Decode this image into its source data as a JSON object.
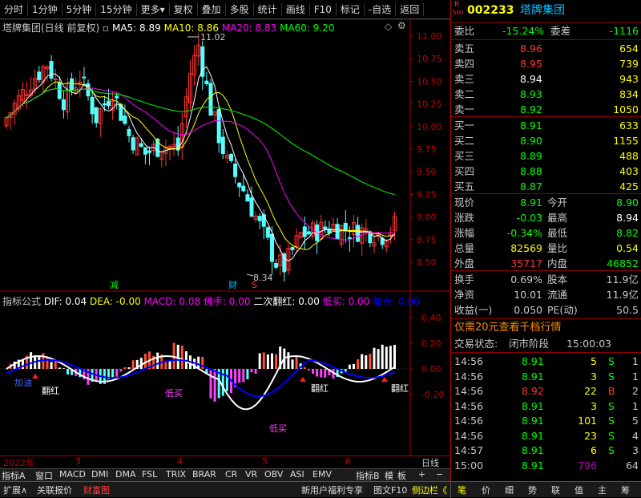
{
  "toolbar": {
    "items": [
      "分时",
      "1分钟",
      "5分钟",
      "15分钟",
      "更多",
      "复权",
      "叠加",
      "多股",
      "统计",
      "画线",
      "F10",
      "标记",
      "-自选",
      "返回"
    ]
  },
  "chart": {
    "title": "塔牌集团(日线 前复权)",
    "ma5": "MA5: 8.89",
    "ma10": "MA10: 8.86",
    "ma20": "MA20: 8.83",
    "ma60": "MA60: 9.20",
    "high_label": "11.02",
    "low_label": "8.34",
    "price_ticks": [
      "11.00",
      "10.75",
      "10.50",
      "10.25",
      "10.00",
      "9.75",
      "9.50",
      "9.25",
      "9.00",
      "8.75",
      "8.50"
    ],
    "markers": {
      "jian": "减",
      "cai": "财",
      "s": "S"
    },
    "colors": {
      "up": "#ff3232",
      "down": "#54ffff",
      "ma5": "#ffffff",
      "ma10": "#ffff00",
      "ma20": "#ff00ff",
      "ma60": "#00ff00"
    }
  },
  "indicator": {
    "title": "指标公式",
    "dif": "DIF: 0.04",
    "dea": "DEA: -0.00",
    "macd": "MACD: 0.08",
    "foshou": "佛手: 0.00",
    "erci": "二次翻红: 0.00",
    "dimai": "低买: 0.00",
    "jiacang": "加仓: 0.00",
    "ticks": [
      "0.40",
      "0.20",
      "0.00",
      "-0.20"
    ],
    "notes": {
      "jiacang": "加油",
      "fanhong": "翻红",
      "dimai1": "低买",
      "dimai2": "低买",
      "fanhong2": "翻红",
      "fanhong3": "翻红"
    }
  },
  "xaxis": {
    "labels": [
      "2022年",
      "3",
      "4",
      "5",
      "6"
    ],
    "period": "日线"
  },
  "tabs": {
    "left": [
      "指标A",
      "窗口",
      "MACD",
      "DMI",
      "DMA",
      "FSL",
      "TRIX",
      "BRAR",
      "CR",
      "VR",
      "OBV",
      "ASI",
      "EMV"
    ],
    "right": [
      "指标B",
      "模",
      "板",
      "+",
      "−"
    ]
  },
  "quote": {
    "logo_r": "R",
    "logo_num": "500",
    "code": "002233",
    "name": "塔牌集团",
    "weibi_label": "委比",
    "weibi": "-15.24%",
    "weicha_label": "委差",
    "weicha": "-1116",
    "asks": [
      {
        "label": "卖五",
        "price": "8.96",
        "vol": "654"
      },
      {
        "label": "卖四",
        "price": "8.95",
        "vol": "739"
      },
      {
        "label": "卖三",
        "price": "8.94",
        "vol": "943"
      },
      {
        "label": "卖二",
        "price": "8.93",
        "vol": "834"
      },
      {
        "label": "卖一",
        "price": "8.92",
        "vol": "1050"
      }
    ],
    "bids": [
      {
        "label": "买一",
        "price": "8.91",
        "vol": "633"
      },
      {
        "label": "买二",
        "price": "8.90",
        "vol": "1155"
      },
      {
        "label": "买三",
        "price": "8.89",
        "vol": "488"
      },
      {
        "label": "买四",
        "price": "8.88",
        "vol": "403"
      },
      {
        "label": "买五",
        "price": "8.87",
        "vol": "425"
      }
    ],
    "stats": [
      {
        "l1": "现价",
        "v1": "8.91",
        "l2": "今开",
        "v2": "8.90"
      },
      {
        "l1": "涨跌",
        "v1": "-0.03",
        "l2": "最高",
        "v2": "8.94"
      },
      {
        "l1": "涨幅",
        "v1": "-0.34%",
        "l2": "最低",
        "v2": "8.82"
      },
      {
        "l1": "总量",
        "v1": "82569",
        "l2": "量比",
        "v2": "0.54"
      },
      {
        "l1": "外盘",
        "v1": "35717",
        "l2": "内盘",
        "v2": "46852"
      }
    ],
    "stats2": [
      {
        "l1": "换手",
        "v1": "0.69%",
        "l2": "股本",
        "v2": "11.9亿"
      },
      {
        "l1": "净资",
        "v1": "10.01",
        "l2": "流通",
        "v2": "11.9亿"
      },
      {
        "l1": "收益(一)",
        "v1": "0.050",
        "l2": "PE(动)",
        "v2": "50.5"
      }
    ],
    "promo": "仅需20元查看千档行情",
    "status_label": "交易状态:",
    "status": "闭市阶段",
    "status_time": "15:00:03",
    "ticks": [
      {
        "t": "14:56",
        "p": "8.91",
        "v": "5",
        "s": "S",
        "n": "1"
      },
      {
        "t": "14:56",
        "p": "8.91",
        "v": "3",
        "s": "S",
        "n": "1"
      },
      {
        "t": "14:56",
        "p": "8.92",
        "v": "22",
        "s": "B",
        "n": "2"
      },
      {
        "t": "14:56",
        "p": "8.91",
        "v": "3",
        "s": "S",
        "n": "1"
      },
      {
        "t": "14:56",
        "p": "8.91",
        "v": "101",
        "s": "S",
        "n": "5"
      },
      {
        "t": "14:56",
        "p": "8.91",
        "v": "23",
        "s": "S",
        "n": "4"
      },
      {
        "t": "14:57",
        "p": "8.91",
        "v": "6",
        "s": "S",
        "n": "3"
      },
      {
        "t": "15:00",
        "p": "8.91",
        "v": "796",
        "s": "",
        "n": "64"
      }
    ]
  },
  "bottom": {
    "left": [
      "扩展∧",
      "关联报价",
      "财富图"
    ],
    "promo": "新用户福利专享",
    "f10": "图文F10",
    "side": "侧边栏《",
    "right": [
      "笔",
      "价",
      "细",
      "势",
      "联",
      "值",
      "主",
      "筹"
    ]
  }
}
